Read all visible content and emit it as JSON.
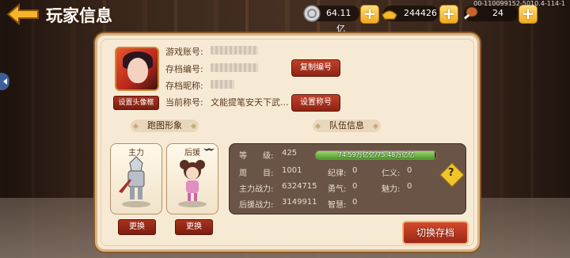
{
  "header": {
    "title": "玩家信息",
    "build_id": "00-110099152-5010.4-114-1"
  },
  "resources": [
    {
      "icon": "silver-coin-icon",
      "value": "64.11亿"
    },
    {
      "icon": "gold-ingot-icon",
      "value": "244426"
    },
    {
      "icon": "stamina-drumstick-icon",
      "value": "24"
    }
  ],
  "profile": {
    "account_label": "游戏账号:",
    "save_id_label": "存档编号:",
    "nickname_label": "存档昵称:",
    "title_label": "当前称号:",
    "title_value": "文能提笔安天下武...",
    "copy_id_button": "复制编号",
    "set_title_button": "设置称号",
    "set_avatar_frame_button": "设置头像框"
  },
  "sections": {
    "run_image": "跑图形象",
    "team_info": "队伍信息"
  },
  "characters": {
    "main_label": "主力",
    "support_label": "后援",
    "change_button": "更换"
  },
  "team": {
    "level_label": "等　　级:",
    "level_value": "425",
    "exp_text": "74.59万亿亿/75.48万亿亿",
    "exp_progress": 0.988,
    "week_label": "周　　目:",
    "week_value": "1001",
    "discipline_label": "纪律:",
    "discipline_value": "0",
    "benevolence_label": "仁义:",
    "benevolence_value": "0",
    "main_power_label": "主力战力:",
    "main_power_value": "6324715",
    "courage_label": "勇气:",
    "courage_value": "0",
    "charm_label": "魅力:",
    "charm_value": "0",
    "support_power_label": "后援战力:",
    "support_power_value": "3149911",
    "wisdom_label": "智慧:",
    "wisdom_value": "0",
    "help_icon": "question-diamond-icon"
  },
  "switch_save_button": "切换存档",
  "colors": {
    "panel_bg": "#f7ead4",
    "button_red": "#9c2816",
    "exp_green": "#4e9a2a",
    "stat_box": "#6a5446"
  }
}
